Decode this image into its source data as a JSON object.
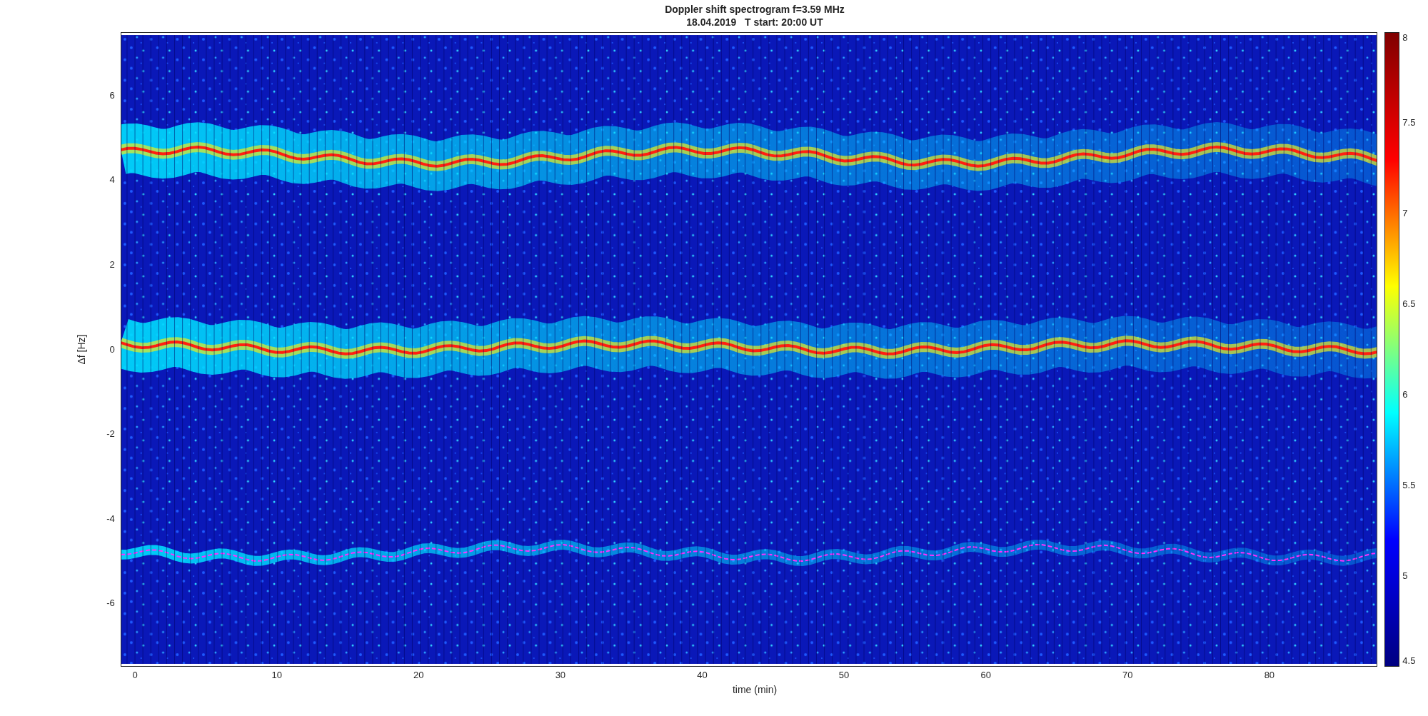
{
  "title": {
    "line1": "Doppler shift spectrogram f=3.59 MHz",
    "line2": "18.04.2019   T start: 20:00 UT"
  },
  "x_axis": {
    "label": "time (min)",
    "ticks": [
      "0",
      "10",
      "20",
      "30",
      "40",
      "50",
      "60",
      "70",
      "80"
    ]
  },
  "y_axis": {
    "label": "Δf [Hz]",
    "ticks": [
      "6",
      "4",
      "2",
      "0",
      "-2",
      "-4",
      "-6"
    ]
  },
  "colorbar": {
    "ticks": [
      "8",
      "7.5",
      "7",
      "6.5",
      "6",
      "5.5",
      "5",
      "4.5"
    ]
  }
}
